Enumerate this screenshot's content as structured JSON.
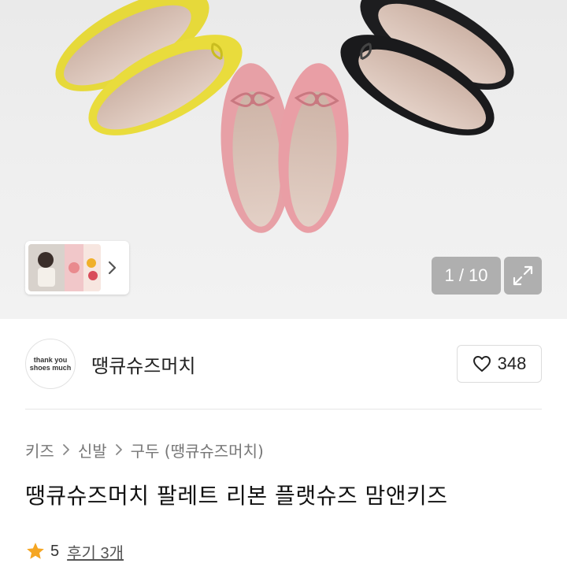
{
  "gallery": {
    "counter": "1 / 10",
    "colors": {
      "yellow": "#e6d93a",
      "pink": "#e7a0a6",
      "black": "#1d1d1f",
      "insole": "#d9c4b8"
    }
  },
  "store": {
    "name": "땡큐슈즈머치",
    "logo_lines": [
      "thank you",
      "shoes much"
    ],
    "likes": "348"
  },
  "breadcrumb": {
    "items": [
      "키즈",
      "신발",
      "구두 (땡큐슈즈머치)"
    ]
  },
  "product": {
    "title": "땡큐슈즈머치 팔레트 리본 플랫슈즈 맘앤키즈",
    "rating": "5",
    "reviews": "후기 3개",
    "star_color": "#f5a623"
  },
  "icons": {
    "thumb_arrow": "chevron-right-icon",
    "expand": "expand-icon",
    "like": "heart-icon",
    "crumb_separator": "chevron-right-icon",
    "rating": "star-icon"
  }
}
